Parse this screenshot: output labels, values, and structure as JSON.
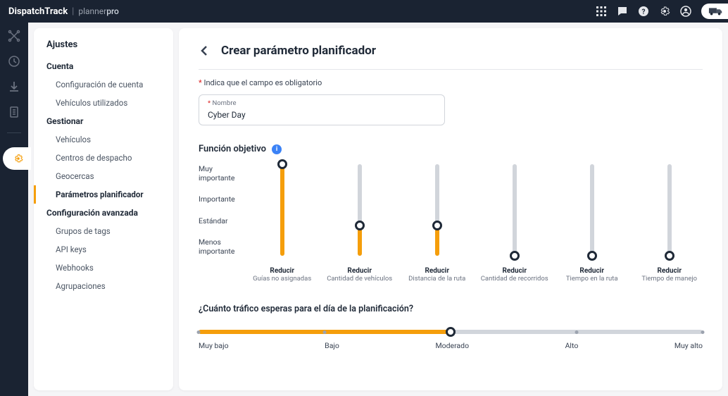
{
  "brand": {
    "main": "DispatchTrack",
    "sep": "|",
    "sub_prefix": "planner",
    "sub_bold": "pro"
  },
  "sidebar": {
    "title": "Ajustes",
    "sections": [
      {
        "label": "Cuenta",
        "items": [
          "Configuración de cuenta",
          "Vehículos utilizados"
        ]
      },
      {
        "label": "Gestionar",
        "items": [
          "Vehículos",
          "Centros de despacho",
          "Geocercas",
          "Parámetros planificador"
        ]
      },
      {
        "label": "Configuración avanzada",
        "items": [
          "Grupos de tags",
          "API keys",
          "Webhooks",
          "Agrupaciones"
        ]
      }
    ],
    "active": "Parámetros planificador"
  },
  "page": {
    "title": "Crear parámetro planificador",
    "required_note_prefix": "*",
    "required_note": " Indica que el campo es obligatorio",
    "field_name_label": "Nombre",
    "field_name_value": "Cyber Day"
  },
  "objective": {
    "title": "Función objetivo",
    "y_levels": [
      "Muy importante",
      "Importante",
      "Estándar",
      "Menos importante"
    ],
    "sliders": [
      {
        "top": "Reducir",
        "sub": "Guías no asignadas",
        "level": 3
      },
      {
        "top": "Reducir",
        "sub": "Cantidad de vehículos",
        "level": 1
      },
      {
        "top": "Reducir",
        "sub": "Distancia de la ruta",
        "level": 1
      },
      {
        "top": "Reducir",
        "sub": "Cantidad de recorridos",
        "level": 0
      },
      {
        "top": "Reducir",
        "sub": "Tiempo en la ruta",
        "level": 0
      },
      {
        "top": "Reducir",
        "sub": "Tiempo de manejo",
        "level": 0
      }
    ]
  },
  "traffic": {
    "title": "¿Cuánto tráfico esperas para el día de la planificación?",
    "labels": [
      "Muy bajo",
      "Bajo",
      "Moderado",
      "Alto",
      "Muy alto"
    ],
    "value_index": 2
  }
}
